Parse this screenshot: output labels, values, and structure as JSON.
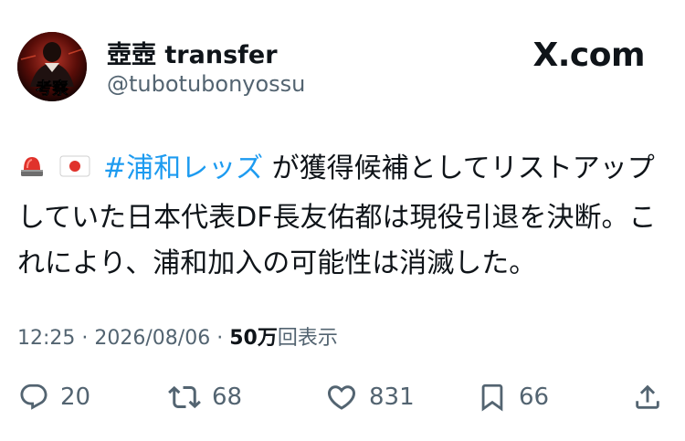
{
  "header": {
    "display_name": "壺壺 transfer",
    "handle": "@tubotubonyossu",
    "brand": "X.com",
    "avatar_text": "考察"
  },
  "tweet": {
    "emoji_siren": "siren-emoji",
    "emoji_flag": "japan-flag-emoji",
    "hashtag": "#浦和レッズ",
    "text": " が獲得候補としてリストアップしていた日本代表DF長友佑都は現役引退を決断。これにより、浦和加入の可能性は消滅した。"
  },
  "meta": {
    "time": "12:25",
    "separator": "·",
    "date": "2026/08/06",
    "views_count": "50万",
    "views_label": "回表示"
  },
  "actions": {
    "replies": "20",
    "reposts": "68",
    "likes": "831",
    "bookmarks": "66"
  },
  "colors": {
    "text": "#0f1419",
    "secondary": "#536471",
    "link": "#1d9bf0"
  }
}
